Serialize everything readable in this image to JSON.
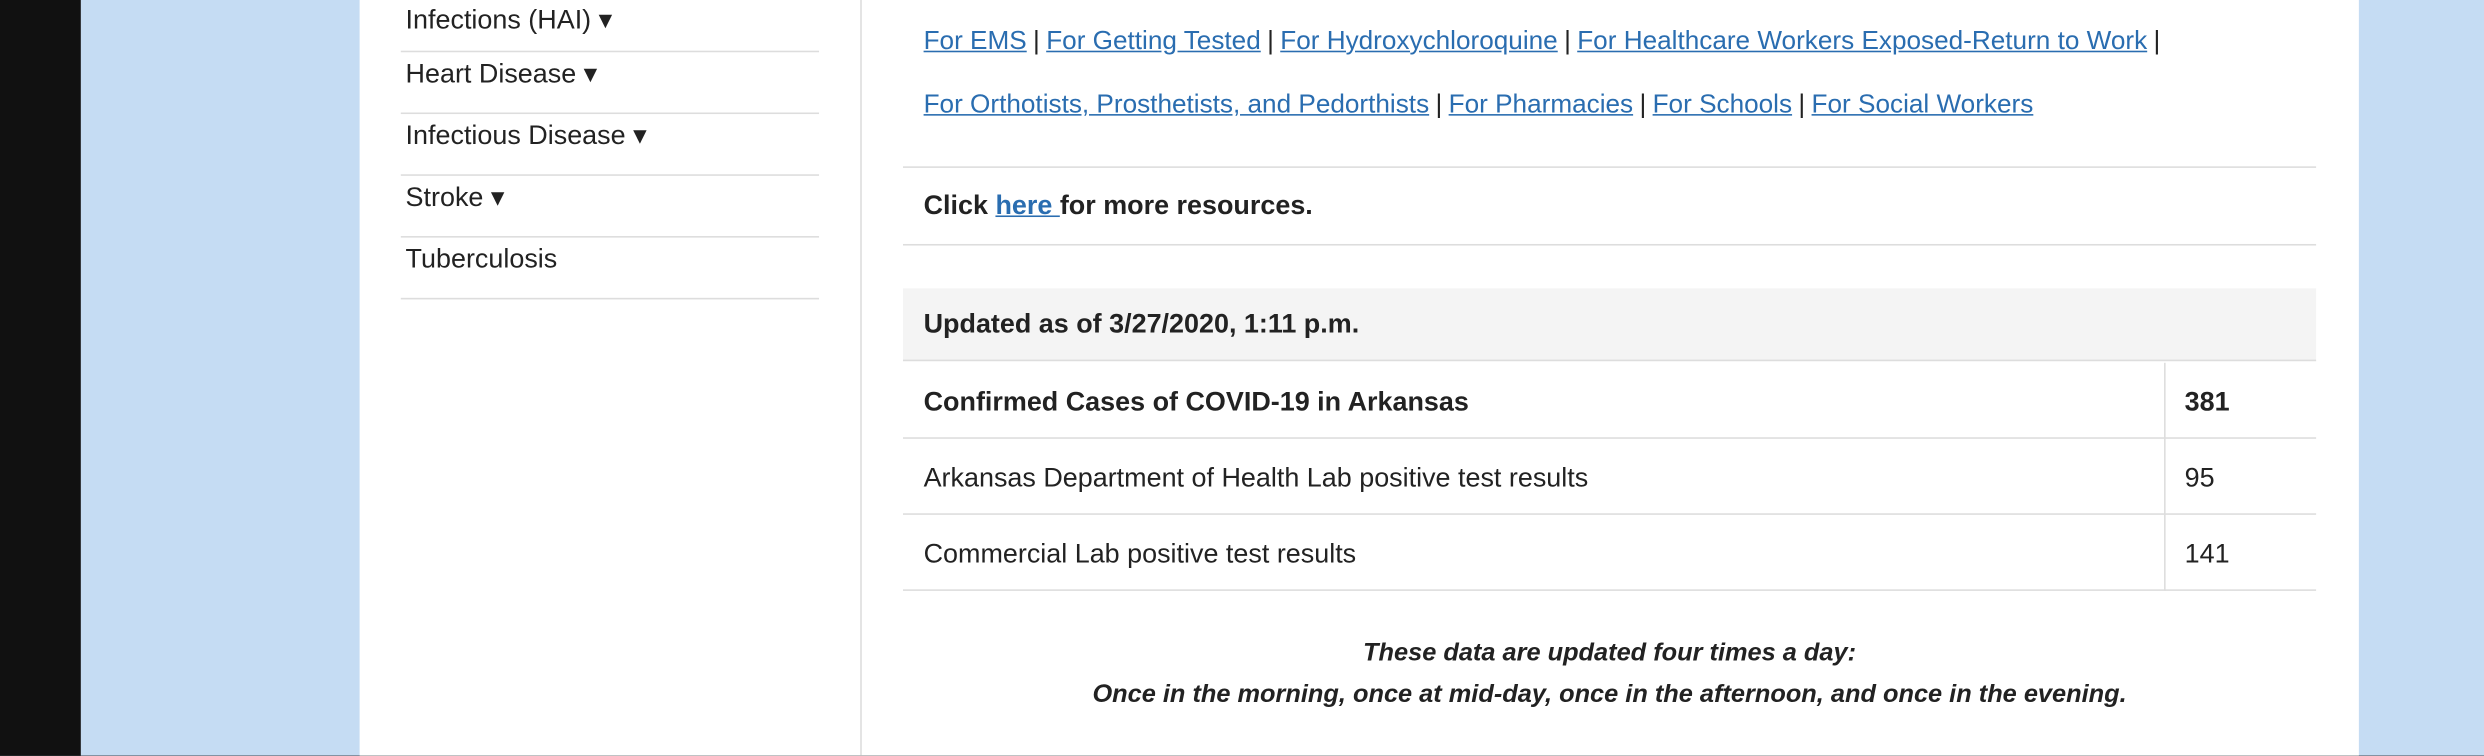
{
  "sidebar": {
    "items": [
      {
        "label": "Infections (HAI) ▾"
      },
      {
        "label": "Heart Disease ▾"
      },
      {
        "label": "Infectious Disease ▾"
      },
      {
        "label": "Stroke ▾"
      },
      {
        "label": "Tuberculosis"
      }
    ]
  },
  "resources": {
    "row1": [
      "For EMS",
      "For Getting Tested",
      "For Hydroxychloroquine",
      "For Healthcare Workers Exposed-Return to Work"
    ],
    "row2": [
      "For Orthotists, Prosthetists, and Pedorthists",
      "For Pharmacies",
      "For Schools",
      "For Social Workers"
    ],
    "separator": "|"
  },
  "click": {
    "prefix": "Click ",
    "link": "here ",
    "suffix": "for more resources."
  },
  "table": {
    "updated": "Updated as of 3/27/2020, 1:11 p.m.",
    "rows": [
      {
        "label": "Confirmed Cases of COVID-19 in Arkansas",
        "value": "381"
      },
      {
        "label": "Arkansas Department of Health Lab positive test results",
        "value": "95"
      },
      {
        "label": "Commercial Lab positive test results",
        "value": "141"
      }
    ]
  },
  "note": {
    "line1": "These data are updated four times a day:",
    "line2": "Once in the morning, once at mid-day, once in the afternoon, and once in the evening."
  }
}
